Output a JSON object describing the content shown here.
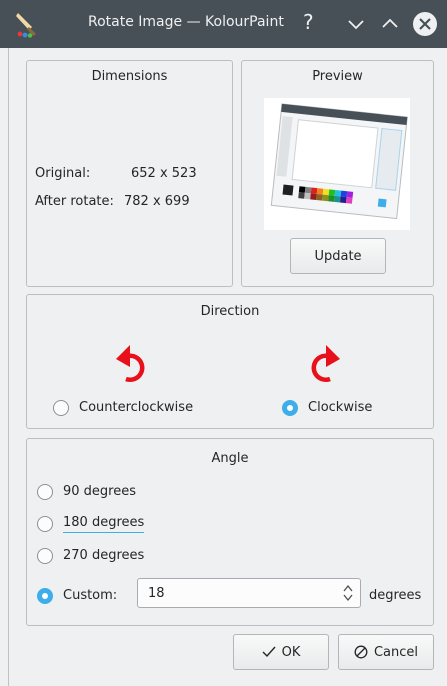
{
  "window": {
    "title": "Rotate Image — KolourPaint",
    "help_glyph": "?"
  },
  "dimensions": {
    "title": "Dimensions",
    "original_label": "Original:",
    "original_value": "652 x 523",
    "after_label": "After rotate:",
    "after_value": "782 x 699"
  },
  "preview": {
    "title": "Preview",
    "update_label": "Update"
  },
  "direction": {
    "title": "Direction",
    "ccw_label": "Counterclockwise",
    "cw_label": "Clockwise",
    "selected": "Clockwise",
    "arrow_color": "#e8101a"
  },
  "angle": {
    "title": "Angle",
    "options": [
      {
        "label": "90 degrees",
        "checked": false
      },
      {
        "label": "180 degrees",
        "checked": false
      },
      {
        "label": "270 degrees",
        "checked": false
      }
    ],
    "custom_label": "Custom:",
    "custom_checked": true,
    "custom_value": "18",
    "unit_label": "degrees"
  },
  "buttons": {
    "ok_label": "OK",
    "cancel_label": "Cancel"
  },
  "colors": {
    "titlebar": "#475057",
    "accent": "#3daee9",
    "background": "#eff0f1"
  }
}
